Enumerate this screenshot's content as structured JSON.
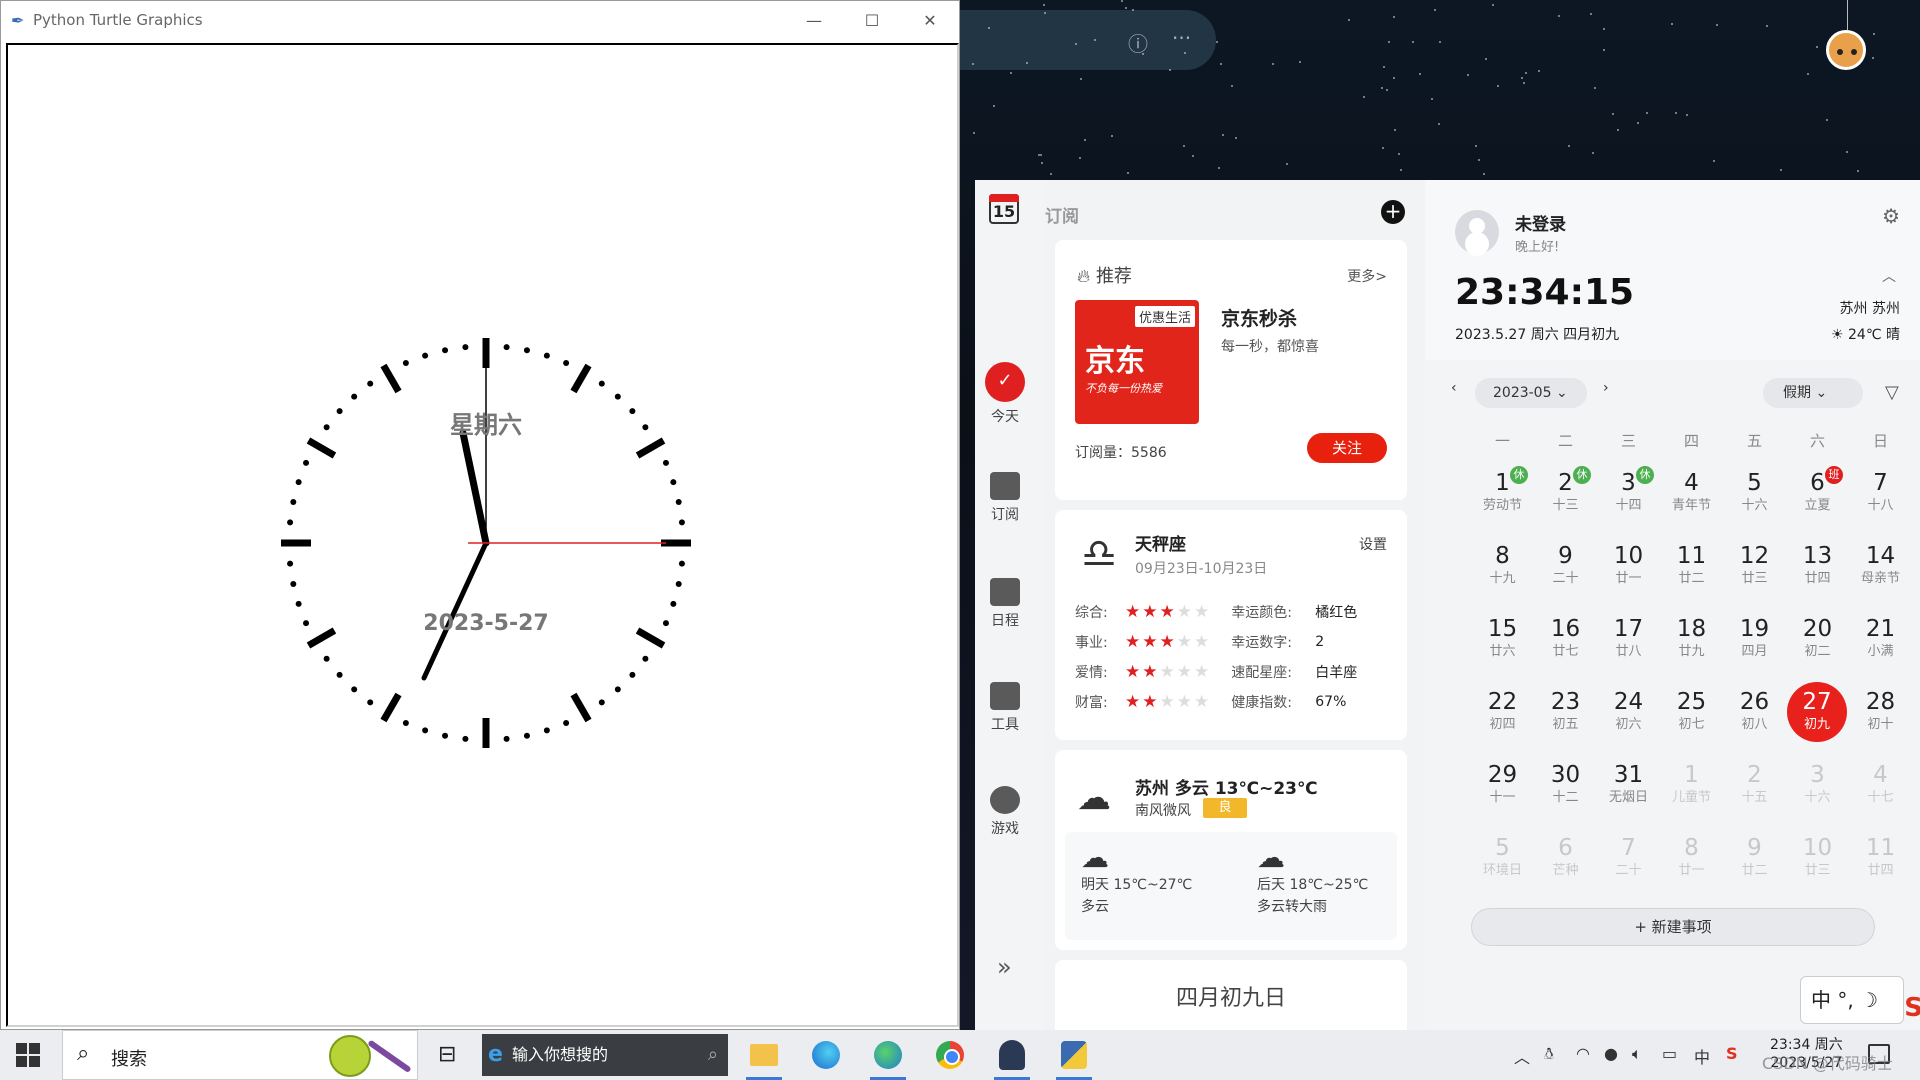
{
  "turtle_window": {
    "title": "Python Turtle Graphics",
    "controls": {
      "minimize": "—",
      "maximize": "☐",
      "close": "✕"
    },
    "clock": {
      "weekday": "星期六",
      "date": "2023-5-27",
      "hour_hand_value": 11.55,
      "minute_hand_value": 34,
      "second_hand_value": 15
    }
  },
  "calendar_widget": {
    "rail": {
      "date_icon": "15",
      "items": [
        {
          "label": "今天",
          "icon": "calendar-check-icon",
          "active": true
        },
        {
          "label": "订阅",
          "icon": "subscribe-calendar-icon"
        },
        {
          "label": "日程",
          "icon": "schedule-grid-icon"
        },
        {
          "label": "工具",
          "icon": "toolbox-icon"
        },
        {
          "label": "游戏",
          "icon": "game-icon"
        }
      ],
      "expand": "»"
    },
    "feed": {
      "title": "订阅",
      "add": "+",
      "recommend": {
        "header": "推荐",
        "more": "更多>",
        "tag": "优惠生活",
        "logo": "京东",
        "slogan": "不负每一份热爱",
        "name": "京东秒杀",
        "desc": "每一秒，都惊喜",
        "subs": "订阅量：5586",
        "follow": "关注"
      },
      "horoscope": {
        "name": "天秤座",
        "range": "09月23日-10月23日",
        "settings": "设置",
        "rows": [
          {
            "label": "综合:",
            "stars": 3,
            "key": "幸运颜色:",
            "value": "橘红色"
          },
          {
            "label": "事业:",
            "stars": 3,
            "key": "幸运数字:",
            "value": "2"
          },
          {
            "label": "爱情:",
            "stars": 2,
            "key": "速配星座:",
            "value": "白羊座"
          },
          {
            "label": "财富:",
            "stars": 2,
            "key": "健康指数:",
            "value": "67%"
          }
        ]
      },
      "weather": {
        "title": "苏州 多云  13℃~23℃",
        "wind": "南风微风",
        "aqi": "良",
        "forecast": [
          {
            "line1": "明天 15℃~27℃",
            "line2": "多云",
            "icon": "cloud-icon"
          },
          {
            "line1": "后天 18℃~25℃",
            "line2": "多云转大雨",
            "icon": "rain-cloud-icon"
          }
        ]
      },
      "lunar_card": "四月初九日"
    },
    "panel": {
      "user": "未登录",
      "greeting": "晚上好!",
      "time": "23:34:15",
      "date_line": "2023.5.27 周六 四月初九",
      "city": "苏州 苏州",
      "weather": "☀ 24℃ 晴",
      "month": "2023-05",
      "holiday": "假期",
      "weekdays": [
        "一",
        "二",
        "三",
        "四",
        "五",
        "六",
        "日"
      ],
      "days": [
        {
          "n": "1",
          "l": "劳动节",
          "b": "休"
        },
        {
          "n": "2",
          "l": "十三",
          "b": "休"
        },
        {
          "n": "3",
          "l": "十四",
          "b": "休"
        },
        {
          "n": "4",
          "l": "青年节"
        },
        {
          "n": "5",
          "l": "十六"
        },
        {
          "n": "6",
          "l": "立夏",
          "b": "班",
          "red": true
        },
        {
          "n": "7",
          "l": "十八"
        },
        {
          "n": "8",
          "l": "十九"
        },
        {
          "n": "9",
          "l": "二十"
        },
        {
          "n": "10",
          "l": "廿一"
        },
        {
          "n": "11",
          "l": "廿二"
        },
        {
          "n": "12",
          "l": "廿三"
        },
        {
          "n": "13",
          "l": "廿四"
        },
        {
          "n": "14",
          "l": "母亲节"
        },
        {
          "n": "15",
          "l": "廿六"
        },
        {
          "n": "16",
          "l": "廿七"
        },
        {
          "n": "17",
          "l": "廿八"
        },
        {
          "n": "18",
          "l": "廿九"
        },
        {
          "n": "19",
          "l": "四月"
        },
        {
          "n": "20",
          "l": "初二"
        },
        {
          "n": "21",
          "l": "小满"
        },
        {
          "n": "22",
          "l": "初四"
        },
        {
          "n": "23",
          "l": "初五"
        },
        {
          "n": "24",
          "l": "初六"
        },
        {
          "n": "25",
          "l": "初七"
        },
        {
          "n": "26",
          "l": "初八"
        },
        {
          "n": "27",
          "l": "初九",
          "sel": true
        },
        {
          "n": "28",
          "l": "初十"
        },
        {
          "n": "29",
          "l": "十一"
        },
        {
          "n": "30",
          "l": "十二"
        },
        {
          "n": "31",
          "l": "无烟日"
        },
        {
          "n": "1",
          "l": "儿童节",
          "fade": true
        },
        {
          "n": "2",
          "l": "十五",
          "fade": true
        },
        {
          "n": "3",
          "l": "十六",
          "fade": true
        },
        {
          "n": "4",
          "l": "十七",
          "fade": true
        },
        {
          "n": "5",
          "l": "环境日",
          "fade": true
        },
        {
          "n": "6",
          "l": "芒种",
          "fade": true
        },
        {
          "n": "7",
          "l": "二十",
          "fade": true
        },
        {
          "n": "8",
          "l": "廿一",
          "fade": true
        },
        {
          "n": "9",
          "l": "廿二",
          "fade": true
        },
        {
          "n": "10",
          "l": "廿三",
          "fade": true
        },
        {
          "n": "11",
          "l": "廿四",
          "fade": true
        }
      ],
      "new_event": "+ 新建事项"
    },
    "ime": "中 °, ☽"
  },
  "taskbar": {
    "search_text": "搜索",
    "ie_text": "输入你想搜的",
    "clock_time": "23:34 周六",
    "clock_date": "2023/5/27",
    "tray_lang": "中",
    "watermark": "CSDN @代码骑士"
  }
}
